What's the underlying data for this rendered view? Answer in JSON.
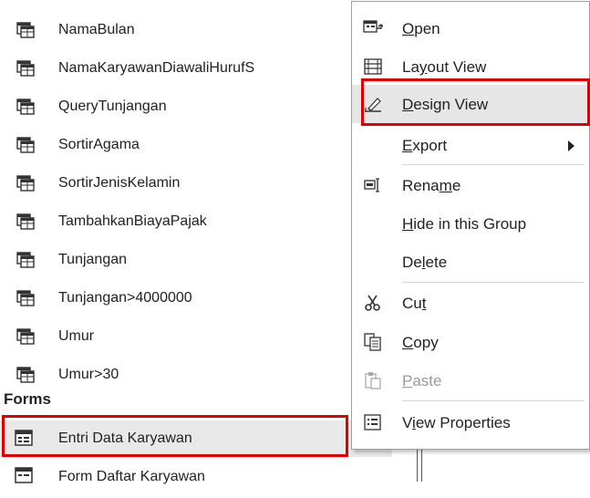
{
  "queries": [
    {
      "label": "NamaBulan"
    },
    {
      "label": "NamaKaryawanDiawaliHurufS"
    },
    {
      "label": "QueryTunjangan"
    },
    {
      "label": "SortirAgama"
    },
    {
      "label": "SortirJenisKelamin"
    },
    {
      "label": "TambahkanBiayaPajak"
    },
    {
      "label": "Tunjangan"
    },
    {
      "label": "Tunjangan>4000000"
    },
    {
      "label": "Umur"
    },
    {
      "label": "Umur>30"
    }
  ],
  "forms_group_label": "Forms",
  "forms": [
    {
      "label": "Entri Data Karyawan"
    },
    {
      "label": "Form Daftar Karyawan"
    }
  ],
  "context_menu": {
    "open": {
      "pre": "",
      "key": "O",
      "post": "pen"
    },
    "layout_view": {
      "pre": "La",
      "key": "y",
      "post": "out View"
    },
    "design_view": {
      "pre": "",
      "key": "D",
      "post": "esign View"
    },
    "export": {
      "pre": "",
      "key": "E",
      "post": "xport"
    },
    "rename": {
      "pre": "Rena",
      "key": "m",
      "post": "e"
    },
    "hide": {
      "pre": "",
      "key": "H",
      "post": "ide in this Group"
    },
    "delete": {
      "pre": "De",
      "key": "l",
      "post": "ete"
    },
    "cut": {
      "pre": "Cu",
      "key": "t",
      "post": ""
    },
    "copy": {
      "pre": "",
      "key": "C",
      "post": "opy"
    },
    "paste": {
      "pre": "",
      "key": "P",
      "post": "aste"
    },
    "view_properties": {
      "pre": "V",
      "key": "i",
      "post": "ew Properties"
    }
  },
  "colors": {
    "highlight": "#e00000",
    "hover": "#e6e6e6",
    "disabled_text": "#9a9a9a"
  }
}
